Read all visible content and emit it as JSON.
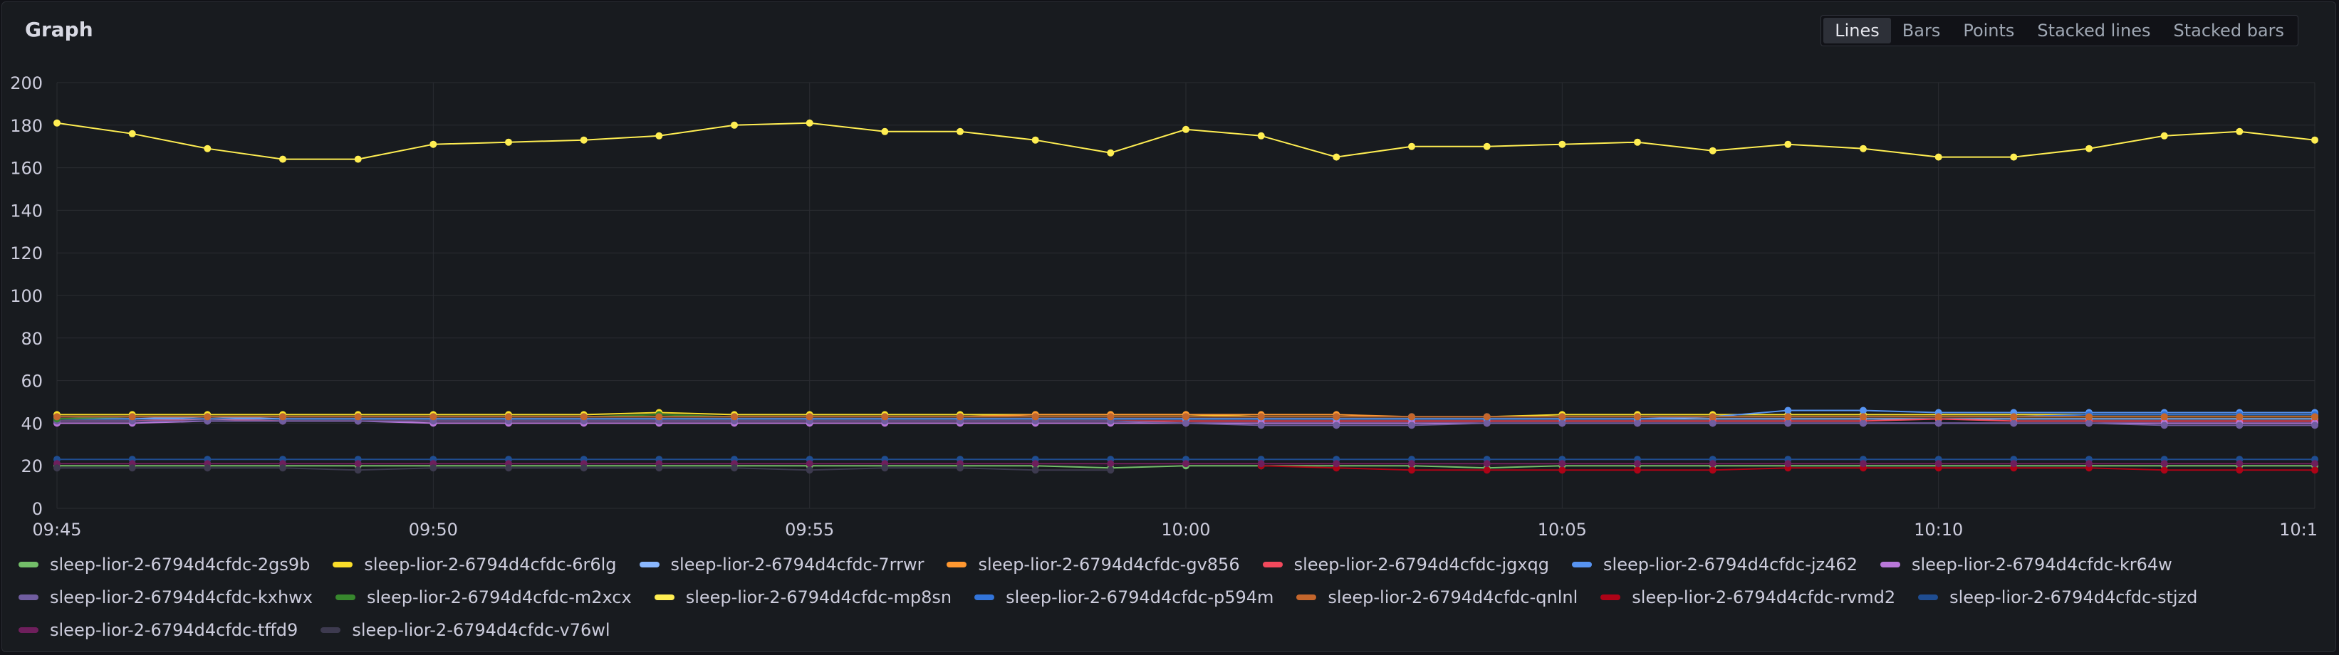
{
  "panel": {
    "title": "Graph",
    "view_options": [
      "Lines",
      "Bars",
      "Points",
      "Stacked lines",
      "Stacked bars"
    ],
    "active_view": "Lines"
  },
  "chart_data": {
    "type": "line",
    "x": [
      "09:45",
      "09:46",
      "09:47",
      "09:48",
      "09:49",
      "09:50",
      "09:51",
      "09:52",
      "09:53",
      "09:54",
      "09:55",
      "09:56",
      "09:57",
      "09:58",
      "09:59",
      "10:00",
      "10:01",
      "10:02",
      "10:03",
      "10:04",
      "10:05",
      "10:06",
      "10:07",
      "10:08",
      "10:09",
      "10:10",
      "10:11",
      "10:12",
      "10:13",
      "10:14",
      "10:15"
    ],
    "x_tick_labels": [
      "09:45",
      "09:50",
      "09:55",
      "10:00",
      "10:05",
      "10:10",
      "10:1"
    ],
    "y_tick_labels": [
      "200",
      "180",
      "160",
      "140",
      "120",
      "100",
      "80",
      "60",
      "40",
      "20",
      "0"
    ],
    "ylim": [
      0,
      200
    ],
    "grid": true,
    "legend_position": "bottom",
    "series": [
      {
        "name": "sleep-lior-2-6794d4cfdc-2gs9b",
        "color": "#73bf69",
        "values": [
          20,
          20,
          20,
          20,
          20,
          20,
          20,
          20,
          20,
          20,
          20,
          20,
          20,
          20,
          19,
          20,
          20,
          20,
          20,
          19,
          20,
          20,
          20,
          20,
          20,
          20,
          20,
          20,
          20,
          20,
          20
        ]
      },
      {
        "name": "sleep-lior-2-6794d4cfdc-6r6lg",
        "color": "#fade2a",
        "values": [
          44,
          44,
          44,
          44,
          44,
          44,
          44,
          44,
          45,
          44,
          44,
          44,
          44,
          44,
          44,
          44,
          43,
          43,
          43,
          43,
          44,
          44,
          44,
          44,
          44,
          44,
          44,
          44,
          44,
          44,
          44
        ]
      },
      {
        "name": "sleep-lior-2-6794d4cfdc-7rrwr",
        "color": "#8ab8ff",
        "values": [
          42,
          42,
          43,
          42,
          42,
          42,
          42,
          42,
          42,
          42,
          42,
          42,
          42,
          42,
          42,
          42,
          42,
          42,
          42,
          42,
          42,
          42,
          42,
          42,
          42,
          42,
          42,
          42,
          42,
          42,
          42
        ]
      },
      {
        "name": "sleep-lior-2-6794d4cfdc-gv856",
        "color": "#ff9830",
        "values": [
          43,
          43,
          43,
          43,
          43,
          43,
          43,
          43,
          43,
          43,
          43,
          43,
          43,
          44,
          44,
          44,
          44,
          44,
          43,
          43,
          43,
          43,
          43,
          43,
          43,
          43,
          43,
          43,
          43,
          43,
          43
        ]
      },
      {
        "name": "sleep-lior-2-6794d4cfdc-jgxqg",
        "color": "#f2495c",
        "values": [
          41,
          41,
          42,
          41,
          41,
          41,
          41,
          41,
          41,
          41,
          41,
          41,
          41,
          41,
          41,
          41,
          41,
          41,
          41,
          41,
          41,
          41,
          41,
          41,
          41,
          42,
          41,
          41,
          41,
          41,
          41
        ]
      },
      {
        "name": "sleep-lior-2-6794d4cfdc-jz462",
        "color": "#5794f2",
        "values": [
          42,
          42,
          42,
          42,
          42,
          42,
          42,
          42,
          42,
          42,
          42,
          42,
          42,
          42,
          42,
          42,
          42,
          42,
          42,
          42,
          42,
          42,
          43,
          46,
          46,
          45,
          45,
          45,
          45,
          45,
          45
        ]
      },
      {
        "name": "sleep-lior-2-6794d4cfdc-kr64w",
        "color": "#b877d9",
        "values": [
          40,
          40,
          41,
          41,
          41,
          40,
          40,
          40,
          40,
          40,
          40,
          40,
          40,
          40,
          40,
          40,
          40,
          40,
          40,
          40,
          40,
          40,
          40,
          40,
          40,
          40,
          40,
          40,
          40,
          40,
          40
        ]
      },
      {
        "name": "sleep-lior-2-6794d4cfdc-kxhwx",
        "color": "#705da0",
        "values": [
          41,
          41,
          41,
          41,
          41,
          41,
          41,
          41,
          41,
          41,
          41,
          41,
          41,
          41,
          41,
          40,
          39,
          39,
          39,
          40,
          40,
          40,
          40,
          40,
          40,
          40,
          40,
          40,
          39,
          39,
          39
        ]
      },
      {
        "name": "sleep-lior-2-6794d4cfdc-m2xcx",
        "color": "#37872d",
        "values": [
          42,
          43,
          43,
          43,
          43,
          43,
          43,
          43,
          44,
          43,
          43,
          43,
          43,
          43,
          43,
          43,
          43,
          43,
          43,
          43,
          43,
          43,
          43,
          43,
          43,
          43,
          43,
          43,
          43,
          43,
          43
        ]
      },
      {
        "name": "sleep-lior-2-6794d4cfdc-mp8sn",
        "color": "#ffee52",
        "values": [
          181,
          176,
          169,
          164,
          164,
          171,
          172,
          173,
          175,
          180,
          181,
          177,
          177,
          173,
          167,
          178,
          175,
          165,
          170,
          170,
          171,
          172,
          168,
          171,
          169,
          165,
          165,
          169,
          175,
          177,
          173
        ]
      },
      {
        "name": "sleep-lior-2-6794d4cfdc-p594m",
        "color": "#3274d9",
        "values": [
          43,
          43,
          43,
          43,
          43,
          43,
          43,
          43,
          43,
          43,
          43,
          43,
          43,
          43,
          43,
          43,
          43,
          43,
          43,
          43,
          43,
          43,
          43,
          43,
          43,
          43,
          43,
          44,
          44,
          44,
          44
        ]
      },
      {
        "name": "sleep-lior-2-6794d4cfdc-qnlnl",
        "color": "#c4662c",
        "values": [
          43,
          43,
          43,
          43,
          43,
          43,
          43,
          43,
          43,
          43,
          43,
          43,
          43,
          43,
          43,
          43,
          43,
          43,
          43,
          43,
          43,
          43,
          43,
          43,
          43,
          43,
          43,
          43,
          43,
          43,
          43
        ]
      },
      {
        "name": "sleep-lior-2-6794d4cfdc-rvmd2",
        "color": "#ad0317",
        "values": [
          null,
          null,
          null,
          null,
          null,
          null,
          null,
          null,
          null,
          null,
          null,
          null,
          null,
          null,
          null,
          null,
          20,
          19,
          18,
          18,
          18,
          18,
          18,
          19,
          19,
          19,
          19,
          19,
          18,
          18,
          18
        ]
      },
      {
        "name": "sleep-lior-2-6794d4cfdc-stjzd",
        "color": "#1f4d91",
        "values": [
          23,
          23,
          23,
          23,
          23,
          23,
          23,
          23,
          23,
          23,
          23,
          23,
          23,
          23,
          23,
          23,
          23,
          23,
          23,
          23,
          23,
          23,
          23,
          23,
          23,
          23,
          23,
          23,
          23,
          23,
          23
        ]
      },
      {
        "name": "sleep-lior-2-6794d4cfdc-tffd9",
        "color": "#6e1f5c",
        "values": [
          21,
          21,
          21,
          21,
          21,
          21,
          21,
          21,
          21,
          21,
          21,
          21,
          21,
          21,
          21,
          21,
          21,
          21,
          21,
          21,
          21,
          21,
          21,
          21,
          21,
          21,
          21,
          21,
          21,
          21,
          21
        ]
      },
      {
        "name": "sleep-lior-2-6794d4cfdc-v76wl",
        "color": "#3d3a4f",
        "values": [
          19,
          19,
          19,
          19,
          18,
          19,
          19,
          19,
          19,
          19,
          18,
          19,
          19,
          18,
          18,
          null,
          null,
          null,
          null,
          null,
          null,
          null,
          null,
          null,
          null,
          null,
          null,
          null,
          null,
          null,
          null
        ]
      }
    ]
  }
}
